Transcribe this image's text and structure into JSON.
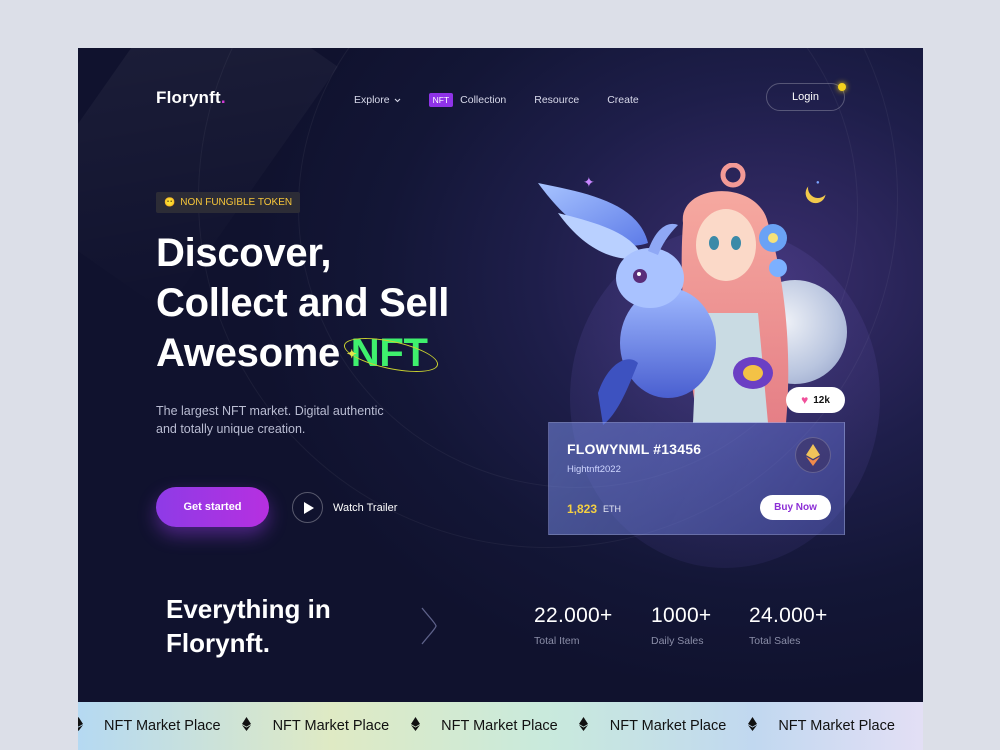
{
  "nav": {
    "logo": "Florynft",
    "logo_dot": ".",
    "items": [
      {
        "label": "Explore"
      },
      {
        "badge": "NFT",
        "label": "Collection"
      },
      {
        "label": "Resource"
      },
      {
        "label": "Create"
      }
    ],
    "login": "Login"
  },
  "hero": {
    "tag": "NON FUNGIBLE TOKEN",
    "line1": "Discover,",
    "line2": "Collect and Sell",
    "line3_prefix": "Awesome ",
    "line3_accent": "NFT",
    "subtext": "The largest NFT market. Digital authentic and totally unique creation.",
    "cta": "Get started",
    "watch": "Watch Trailer"
  },
  "card": {
    "likes": "12k",
    "title": "FLOWYNML #13456",
    "user": "Hightnft2022",
    "price": "1,823",
    "unit": "ETH",
    "buy": "Buy Now"
  },
  "stats": {
    "title_line1": "Everything in",
    "title_line2": "Florynft.",
    "items": [
      {
        "value": "22.000+",
        "label": "Total Item"
      },
      {
        "value": "1000+",
        "label": "Daily Sales"
      },
      {
        "value": "24.000+",
        "label": "Total Sales"
      }
    ]
  },
  "ticker": {
    "items": [
      "NFT Market Place",
      "NFT Market Place",
      "NFT Market Place",
      "NFT Market Place",
      "NFT Market Place"
    ]
  },
  "colors": {
    "accent_purple": "#8f33e8",
    "accent_green": "#3ff06d",
    "price_yellow": "#f5d042",
    "background": "#131636"
  }
}
